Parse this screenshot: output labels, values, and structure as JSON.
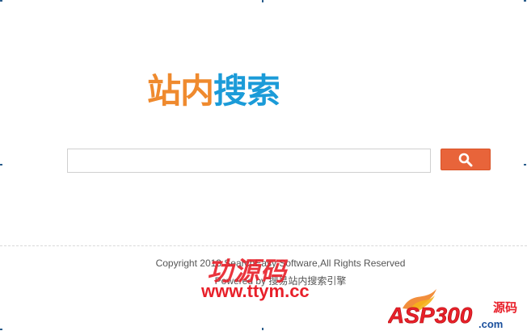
{
  "logo": {
    "part1": "站内",
    "part2": "搜索"
  },
  "search": {
    "placeholder": "",
    "value": ""
  },
  "icons": {
    "search_button_icon": "search-icon"
  },
  "footer": {
    "copyright": "Copyright 2013 SearchEasy Software,All Rights Reserved",
    "powered": "Powered by 搜易站内搜索引擎"
  },
  "watermark": {
    "cn": "功源码",
    "url": "www.ttym.cc",
    "asp_logo_text": "ASP300",
    "asp_logo_sub": ".com",
    "asp_logo_cn": "源码"
  },
  "colors": {
    "accent_orange": "#ef8a2e",
    "accent_blue": "#1b9bd8",
    "button": "#e8643a",
    "watermark_red": "#e8202a"
  }
}
